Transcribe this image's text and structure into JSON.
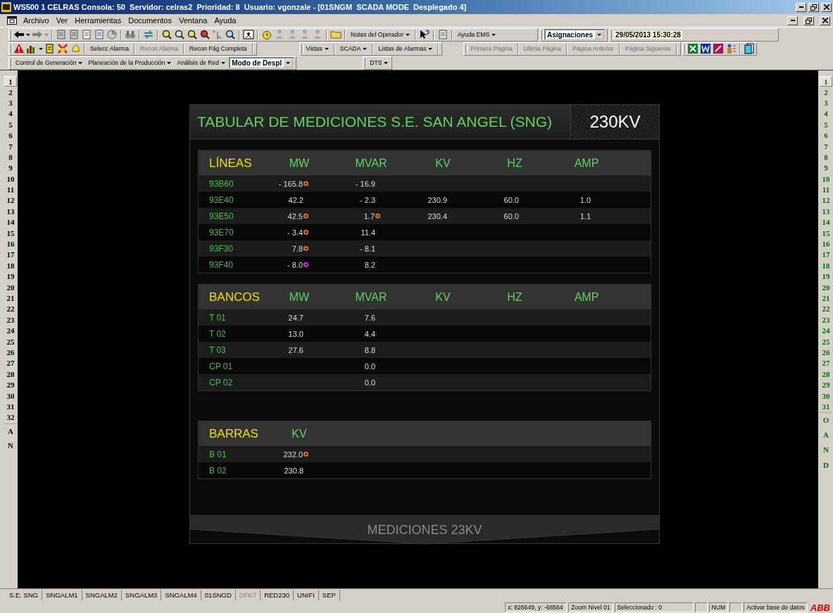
{
  "window": {
    "title": "WS500 1 CELRAS Consola: 50  Servidor: celras2  Prioridad: 8  Usuario: vgonzale - [01SNGM  SCADA MODE  Desplegado 4]"
  },
  "menu": [
    "Archivo",
    "Ver",
    "Herramientas",
    "Documentos",
    "Ventana",
    "Ayuda"
  ],
  "toolbar_1": {
    "operator_notes": "Notas del Operador",
    "help": "Ayuda EMS",
    "assignments": "Asignaciones",
    "datetime": "29/05/2013 15:30:28"
  },
  "toolbar_2": {
    "alarm_buttons": [
      {
        "label": "Selecc Alarma",
        "disabled": false
      },
      {
        "label": "Recon Alarma",
        "disabled": true
      },
      {
        "label": "Recon Pág Completa",
        "disabled": false
      }
    ],
    "menus": [
      "Vistas",
      "SCADA",
      "Listas de Alarmas"
    ],
    "paging": [
      {
        "label": "Primera Página",
        "disabled": true
      },
      {
        "label": "Ultima Página",
        "disabled": true
      },
      {
        "label": "Página Anterior",
        "disabled": true
      },
      {
        "label": "Página Siguiente",
        "disabled": true
      }
    ]
  },
  "toolbar_3": {
    "menus": [
      "Control de Generación",
      "Planeación de la Producción",
      "Análisis de Red"
    ],
    "mode": "Modo de Despl",
    "dts": "DTS"
  },
  "left_bar": [
    {
      "label": "1",
      "selected": true
    },
    {
      "label": "2",
      "selected": false
    },
    {
      "label": "3",
      "selected": false
    },
    {
      "label": "4",
      "selected": false
    },
    {
      "label": "5",
      "selected": false
    },
    {
      "label": "6",
      "selected": false
    },
    {
      "label": "7",
      "selected": false
    },
    {
      "label": "8",
      "selected": false
    },
    {
      "label": "9",
      "selected": false
    },
    {
      "label": "10",
      "selected": false
    },
    {
      "label": "11",
      "selected": false
    },
    {
      "label": "12",
      "selected": false
    },
    {
      "label": "13",
      "selected": false
    },
    {
      "label": "14",
      "selected": false
    },
    {
      "label": "15",
      "selected": false
    },
    {
      "label": "16",
      "selected": false
    },
    {
      "label": "17",
      "selected": false
    },
    {
      "label": "18",
      "selected": false
    },
    {
      "label": "19",
      "selected": false
    },
    {
      "label": "20",
      "selected": false
    },
    {
      "label": "21",
      "selected": false
    },
    {
      "label": "22",
      "selected": false
    },
    {
      "label": "23",
      "selected": false
    },
    {
      "label": "24",
      "selected": false
    },
    {
      "label": "25",
      "selected": false
    },
    {
      "label": "26",
      "selected": false
    },
    {
      "label": "27",
      "selected": false
    },
    {
      "label": "28",
      "selected": false
    },
    {
      "label": "29",
      "selected": false
    },
    {
      "label": "30",
      "selected": false
    },
    {
      "label": "31",
      "selected": false
    },
    {
      "label": "32",
      "selected": false
    },
    {
      "label": "A",
      "selected": false,
      "kind": "group"
    },
    {
      "label": "N",
      "selected": false,
      "kind": "group"
    }
  ],
  "right_bar": [
    {
      "label": "1",
      "selected": true
    },
    {
      "label": "2",
      "selected": false
    },
    {
      "label": "3",
      "selected": false
    },
    {
      "label": "4",
      "selected": false
    },
    {
      "label": "5",
      "selected": false
    },
    {
      "label": "6",
      "selected": false
    },
    {
      "label": "7",
      "selected": false
    },
    {
      "label": "8",
      "selected": false
    },
    {
      "label": "9",
      "selected": false
    },
    {
      "label": "10",
      "selected": false
    },
    {
      "label": "11",
      "selected": false
    },
    {
      "label": "12",
      "selected": false
    },
    {
      "label": "13",
      "selected": false
    },
    {
      "label": "14",
      "selected": false
    },
    {
      "label": "15",
      "selected": false
    },
    {
      "label": "16",
      "selected": false
    },
    {
      "label": "17",
      "selected": false
    },
    {
      "label": "18",
      "selected": false
    },
    {
      "label": "19",
      "selected": false
    },
    {
      "label": "20",
      "selected": false
    },
    {
      "label": "21",
      "selected": false
    },
    {
      "label": "22",
      "selected": false
    },
    {
      "label": "23",
      "selected": false
    },
    {
      "label": "24",
      "selected": false
    },
    {
      "label": "25",
      "selected": false
    },
    {
      "label": "26",
      "selected": false
    },
    {
      "label": "27",
      "selected": false
    },
    {
      "label": "28",
      "selected": false
    },
    {
      "label": "29",
      "selected": false
    },
    {
      "label": "30",
      "selected": false
    },
    {
      "label": "31",
      "selected": false
    },
    {
      "label": "O",
      "selected": false,
      "kind": "group"
    },
    {
      "label": "A",
      "selected": false,
      "kind": "group"
    },
    {
      "label": "N",
      "selected": false,
      "kind": "group"
    },
    {
      "label": "D",
      "selected": false,
      "kind": "group"
    }
  ],
  "display": {
    "title": "TABULAR DE MEDICIONES S.E. SAN ANGEL (SNG)",
    "voltage": "230KV",
    "sections": [
      {
        "kind": "full",
        "title": "LÍNEAS",
        "columns": [
          "MW",
          "MVAR",
          "KV",
          "HZ",
          "AMP"
        ],
        "rows": [
          {
            "name": "93B60",
            "mw": {
              "text": "- 165.8",
              "color": "#e0702a"
            },
            "mvar": {
              "text": "- 16.9"
            }
          },
          {
            "name": "93E40",
            "mw": {
              "text": "42.2"
            },
            "mvar": {
              "text": "- 2.3"
            },
            "kv": {
              "text": "230.9"
            },
            "hz": {
              "text": "60.0"
            },
            "amp": {
              "text": "1.0"
            }
          },
          {
            "name": "93E50",
            "mw": {
              "text": "42.5",
              "color": "#e0702a"
            },
            "mvar": {
              "text": "1.7",
              "color": "#e0702a"
            },
            "kv": {
              "text": "230.4"
            },
            "hz": {
              "text": "60.0"
            },
            "amp": {
              "text": "1.1"
            }
          },
          {
            "name": "93E70",
            "mw": {
              "text": "- 3.4",
              "color": "#e0702a"
            },
            "mvar": {
              "text": "11.4"
            }
          },
          {
            "name": "93F30",
            "mw": {
              "text": "7.8",
              "color": "#e0702a"
            },
            "mvar": {
              "text": "- 8.1"
            }
          },
          {
            "name": "93F40",
            "mw": {
              "text": "- 8.0",
              "color": "#e020e0"
            },
            "mvar": {
              "text": "8.2"
            }
          }
        ]
      },
      {
        "kind": "full",
        "title": "BANCOS",
        "columns": [
          "MW",
          "MVAR",
          "KV",
          "HZ",
          "AMP"
        ],
        "rows": [
          {
            "name": "T 01",
            "mw": {
              "text": "24.7"
            },
            "mvar": {
              "text": "7.6"
            }
          },
          {
            "name": "T 02",
            "mw": {
              "text": "13.0"
            },
            "mvar": {
              "text": "4.4"
            }
          },
          {
            "name": "T 03",
            "mw": {
              "text": "27.6"
            },
            "mvar": {
              "text": "8.8"
            }
          },
          {
            "name": "CP 01",
            "mvar": {
              "text": "0.0"
            }
          },
          {
            "name": "CP 02",
            "mvar": {
              "text": "0.0"
            }
          }
        ]
      },
      {
        "kind": "voltage",
        "title": "BARRAS",
        "columns": [
          "KV"
        ],
        "rows": [
          {
            "name": "B 01",
            "kv": {
              "text": "232.0",
              "color": "#e0702a"
            }
          },
          {
            "name": "B 02",
            "kv": {
              "text": "230.8"
            }
          }
        ]
      }
    ],
    "next_page": "MEDICIONES 23KV"
  },
  "tabs": [
    {
      "label": "S.E. SNG",
      "disabled": false
    },
    {
      "label": "SNGALM1",
      "disabled": false
    },
    {
      "label": "SNGALM2",
      "disabled": false
    },
    {
      "label": "SNGALM3",
      "disabled": false
    },
    {
      "label": "SNGALM4",
      "disabled": false
    },
    {
      "label": "01SNGD",
      "disabled": false
    },
    {
      "label": "DFK7",
      "disabled": true
    },
    {
      "label": "RED230",
      "disabled": false
    },
    {
      "label": "UNIFI",
      "disabled": false
    },
    {
      "label": "SEP",
      "disabled": false
    }
  ],
  "status_bar": {
    "coordinates": "x: 826649, y: -68564",
    "zoom": "Zoom Nivel 01",
    "selected": "Seleccionado : 0",
    "num": "NUM",
    "database": "Activar base de datos",
    "logo": "ABB"
  }
}
